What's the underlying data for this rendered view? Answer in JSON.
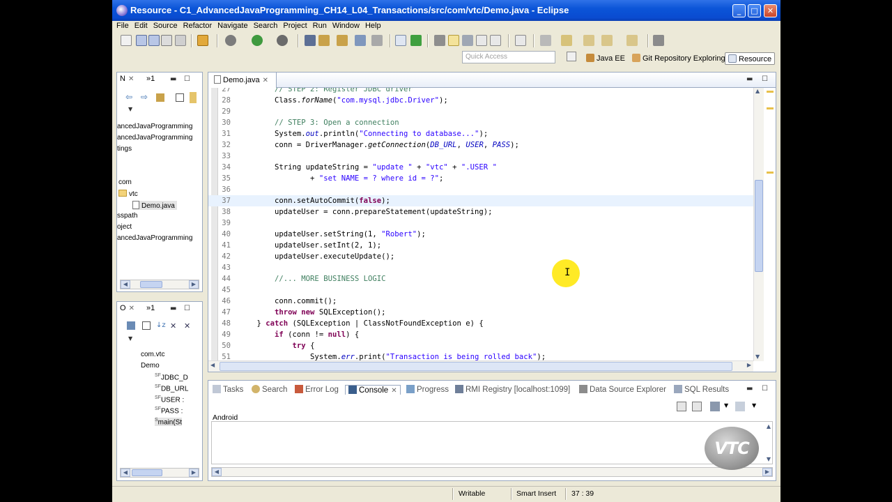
{
  "window": {
    "title": "Resource - C1_AdvancedJavaProgramming_CH14_L04_Transactions/src/com/vtc/Demo.java - Eclipse",
    "minimize": "_",
    "maximize": "□",
    "close": "✕"
  },
  "menu": [
    "File",
    "Edit",
    "Source",
    "Refactor",
    "Navigate",
    "Search",
    "Project",
    "Run",
    "Window",
    "Help"
  ],
  "quick_access": {
    "placeholder": "Quick Access"
  },
  "perspectives": [
    {
      "label": "Java EE",
      "icon": "java-ee-icon"
    },
    {
      "label": "Git Repository Exploring",
      "icon": "git-icon"
    },
    {
      "label": "Resource",
      "icon": "resource-icon",
      "active": true
    }
  ],
  "package_explorer": {
    "tab_label": "N",
    "tab2_label": "»1",
    "items": [
      "ancedJavaProgramming",
      "ancedJavaProgramming",
      "tings",
      "com",
      "vtc",
      "Demo.java",
      "sspath",
      "oject",
      "ancedJavaProgramming"
    ]
  },
  "outline": {
    "tab_label": "O",
    "tab2_label": "»1",
    "items": [
      "com.vtc",
      "Demo",
      "JDBC_D",
      "DB_URL",
      "USER :",
      "PASS : ",
      "main(St"
    ],
    "modifier_badges": [
      "SF",
      "SF",
      "SF",
      "SF",
      "S"
    ]
  },
  "editor": {
    "tab_label": "Demo.java",
    "cursor_line": 37,
    "lines": [
      {
        "n": "27",
        "html": "        <span class=\"cmt\">// STEP 2: Register JDBC driver</span>"
      },
      {
        "n": "28",
        "html": "        Class.<span class=\"it\">forName</span>(<span class=\"str\">\"com.mysql.jdbc.Driver\"</span>);"
      },
      {
        "n": "29",
        "html": ""
      },
      {
        "n": "30",
        "html": "        <span class=\"cmt\">// STEP 3: Open a connection</span>"
      },
      {
        "n": "31",
        "html": "        System.<span class=\"fld\">out</span>.println(<span class=\"str\">\"Connecting to database...\"</span>);"
      },
      {
        "n": "32",
        "html": "        conn = DriverManager.<span class=\"it\">getConnection</span>(<span class=\"fld\">DB_URL</span>, <span class=\"fld\">USER</span>, <span class=\"fld\">PASS</span>);"
      },
      {
        "n": "33",
        "html": ""
      },
      {
        "n": "34",
        "html": "        String updateString = <span class=\"str\">\"update \"</span> + <span class=\"str\">\"vtc\"</span> + <span class=\"str\">\".USER \"</span>"
      },
      {
        "n": "35",
        "html": "                + <span class=\"str\">\"set NAME = ? where id = ?\"</span>;"
      },
      {
        "n": "36",
        "html": ""
      },
      {
        "n": "37",
        "html": "        conn.setAutoCommit(<span class=\"kw\">false</span>);"
      },
      {
        "n": "38",
        "html": "        updateUser = conn.prepareStatement(updateString);"
      },
      {
        "n": "39",
        "html": ""
      },
      {
        "n": "40",
        "html": "        updateUser.setString(1, <span class=\"str\">\"Robert\"</span>);"
      },
      {
        "n": "41",
        "html": "        updateUser.setInt(2, 1);"
      },
      {
        "n": "42",
        "html": "        updateUser.executeUpdate();"
      },
      {
        "n": "43",
        "html": ""
      },
      {
        "n": "44",
        "html": "        <span class=\"cmt\">//... MORE BUSINESS LOGIC</span>"
      },
      {
        "n": "45",
        "html": ""
      },
      {
        "n": "46",
        "html": "        conn.commit();"
      },
      {
        "n": "47",
        "html": "        <span class=\"kw\">throw new</span> SQLException();"
      },
      {
        "n": "48",
        "html": "    } <span class=\"kw\">catch</span> (SQLException | ClassNotFoundException e) {"
      },
      {
        "n": "49",
        "html": "        <span class=\"kw\">if</span> (conn != <span class=\"kw\">null</span>) {"
      },
      {
        "n": "50",
        "html": "            <span class=\"kw\">try</span> {"
      },
      {
        "n": "51",
        "html": "                System.<span class=\"fld\">err</span>.print(<span class=\"str\">\"Transaction is being rolled back\"</span>);"
      }
    ]
  },
  "bottom_panel": {
    "tabs": [
      {
        "label": "Tasks",
        "icon": "tasks-icon"
      },
      {
        "label": "Search",
        "icon": "search-icon"
      },
      {
        "label": "Error Log",
        "icon": "error-log-icon"
      },
      {
        "label": "Console",
        "icon": "console-icon",
        "active": true
      },
      {
        "label": "Progress",
        "icon": "progress-icon"
      },
      {
        "label": "RMI Registry [localhost:1099]",
        "icon": "rmi-icon"
      },
      {
        "label": "Data Source Explorer",
        "icon": "data-source-icon"
      },
      {
        "label": "SQL Results",
        "icon": "sql-results-icon"
      }
    ],
    "console_label": "Android"
  },
  "watermark": "VTC",
  "status": {
    "writable": "Writable",
    "insert_mode": "Smart Insert",
    "position": "37 : 39"
  },
  "colors": {
    "keyword": "#7f0055",
    "string": "#2a00ff",
    "comment": "#3f7f5f",
    "field": "#0000c0",
    "titlebar": "#0b55d8"
  }
}
